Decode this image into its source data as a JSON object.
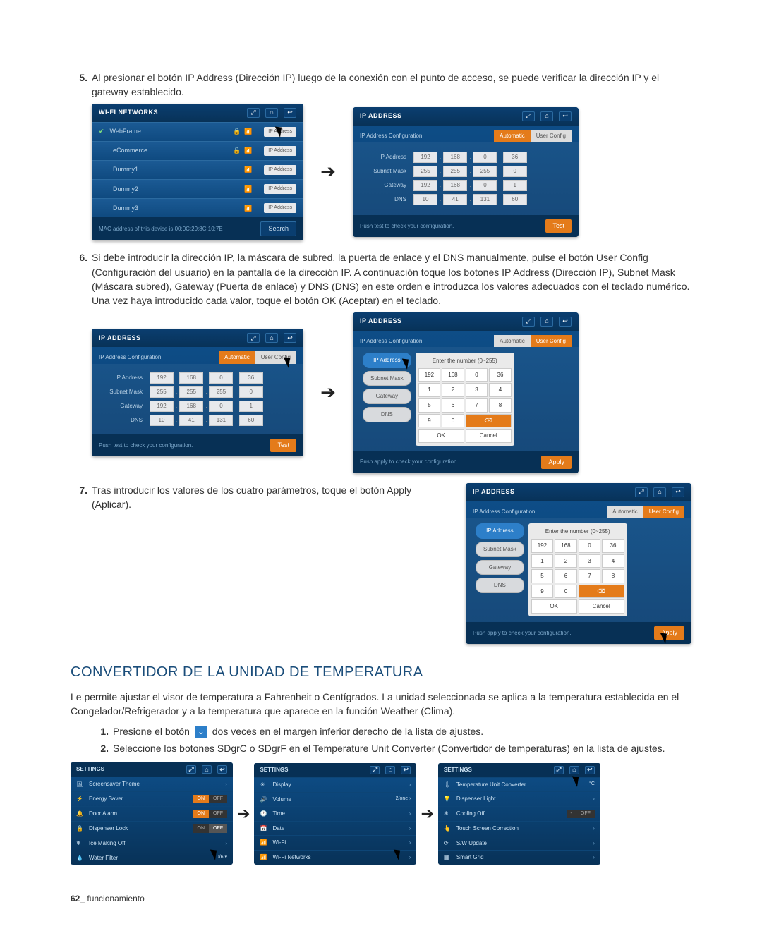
{
  "steps": {
    "s5_num": "5.",
    "s5_text": "Al presionar el botón IP Address (Dirección IP) luego de la conexión con el punto de acceso, se puede verificar la dirección IP y el gateway establecido.",
    "s6_num": "6.",
    "s6_text": "Si debe introducir la dirección IP, la máscara de subred, la puerta de enlace y el DNS manualmente, pulse el botón User Config (Configuración del usuario) en la pantalla de la dirección IP. A continuación toque los botones IP Address (Dirección IP), Subnet Mask (Máscara subred), Gateway (Puerta de enlace) y DNS (DNS) en este orden e introduzca los valores adecuados con el teclado numérico. Una vez haya introducido cada valor, toque el botón OK (Aceptar) en el teclado.",
    "s7_num": "7.",
    "s7_text": "Tras introducir los valores de los cuatro parámetros, toque el botón Apply (Aplicar).",
    "sub1_num": "1.",
    "sub1_pre": "Presione el botón ",
    "sub1_post": " dos veces en el margen inferior derecho de la lista de ajustes.",
    "sub2_num": "2.",
    "sub2_text": "Seleccione los botones SDgrC o SDgrF en el Temperature Unit Converter (Convertidor de temperaturas) en la lista de ajustes."
  },
  "wifi_panel": {
    "title": "WI-FI NETWORKS",
    "items": [
      "WebFrame",
      "eCommerce",
      "Dummy1",
      "Dummy2",
      "Dummy3"
    ],
    "ipaddr_btn": "IP Address",
    "footer_mac": "MAC address of this device is 00:0C:29:8C:10:7E",
    "footer_btn": "Search"
  },
  "ip_panel": {
    "title": "IP ADDRESS",
    "subtitle": "IP Address Configuration",
    "tab_auto": "Automatic",
    "tab_user": "User Config",
    "labels": {
      "ip": "IP Address",
      "mask": "Subnet Mask",
      "gw": "Gateway",
      "dns": "DNS"
    },
    "vals": {
      "ip": [
        "192",
        "168",
        "0",
        "36"
      ],
      "mask": [
        "255",
        "255",
        "255",
        "0"
      ],
      "gw": [
        "192",
        "168",
        "0",
        "1"
      ],
      "dns": [
        "10",
        "41",
        "131",
        "60"
      ]
    },
    "footer_text": "Push test to check your configuration.",
    "footer_apply_text": "Push apply to check your configuration.",
    "btn_test": "Test",
    "btn_apply": "Apply"
  },
  "keypad": {
    "hdr": "Enter the number (0~255)",
    "top": [
      "192",
      "168",
      "0",
      "36"
    ],
    "keys": [
      "1",
      "2",
      "3",
      "4",
      "5",
      "6",
      "7",
      "8",
      "9",
      "0"
    ],
    "ok": "OK",
    "cancel": "Cancel"
  },
  "side_buttons": {
    "ip": "IP Address",
    "mask": "Subnet Mask",
    "gw": "Gateway",
    "dns": "DNS"
  },
  "section_title": "CONVERTIDOR DE LA UNIDAD DE TEMPERATURA",
  "section_intro": "Le permite ajustar el visor de temperatura a Fahrenheit o Centígrados. La unidad seleccionada se aplica a la temperatura establecida en el Congelador/Refrigerador y a la temperatura que aparece en la función Weather (Clima).",
  "settings_title": "SETTINGS",
  "settings1": {
    "items": [
      {
        "label": "Screensaver Theme",
        "right": ">"
      },
      {
        "label": "Energy Saver",
        "right": "toggle"
      },
      {
        "label": "Door Alarm",
        "right": "toggle"
      },
      {
        "label": "Dispenser Lock",
        "right": "toggle2"
      },
      {
        "label": "Ice Making Off",
        "right": ">"
      },
      {
        "label": "Water Filter",
        "right": "count"
      }
    ],
    "on": "ON",
    "off": "OFF",
    "count": "0/6 ▾"
  },
  "settings2": {
    "items": [
      {
        "label": "Display",
        "right": ">"
      },
      {
        "label": "Volume",
        "right": "2/one"
      },
      {
        "label": "Time",
        "right": ">"
      },
      {
        "label": "Date",
        "right": ">"
      },
      {
        "label": "Wi-Fi",
        "right": ">"
      },
      {
        "label": "Wi-Fi Networks",
        "right": ">"
      }
    ],
    "vol": "2/one  ›"
  },
  "settings3": {
    "items": [
      {
        "label": "Temperature Unit Converter",
        "right": "°C"
      },
      {
        "label": "Dispenser Light",
        "right": ">"
      },
      {
        "label": "Cooling Off",
        "right": "toggle"
      },
      {
        "label": "Touch Screen Correction",
        "right": ">"
      },
      {
        "label": "S/W Update",
        "right": ">"
      },
      {
        "label": "Smart Grid",
        "right": ">"
      }
    ]
  },
  "footer": {
    "page": "62",
    "label": "_ funcionamiento"
  }
}
